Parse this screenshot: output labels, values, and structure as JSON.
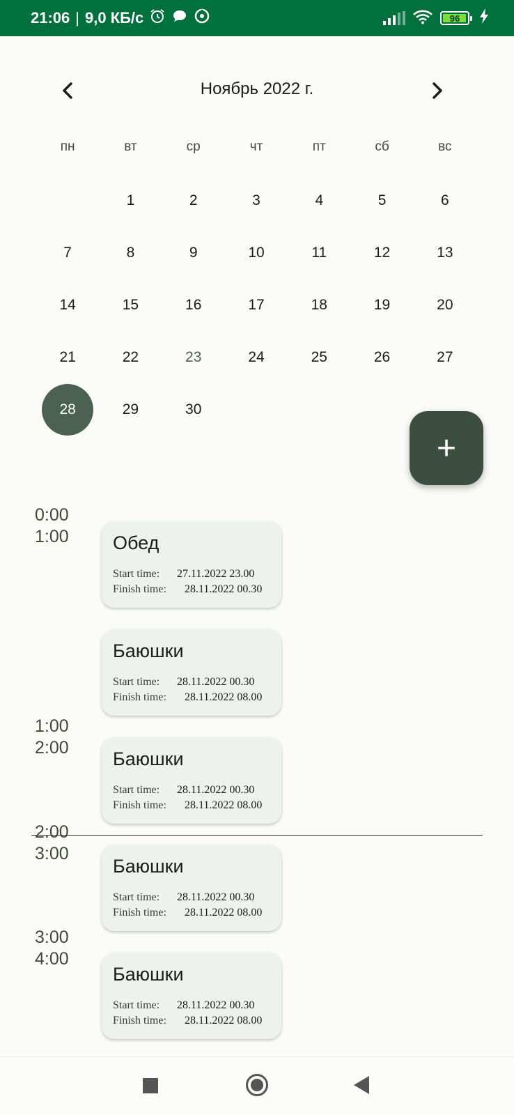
{
  "status_bar": {
    "time": "21:06",
    "separator": "|",
    "speed": "9,0 КБ/с",
    "icons": [
      "alarm-icon",
      "chat-icon",
      "sync-icon"
    ],
    "battery": "96",
    "battery_level": 0.96
  },
  "calendar": {
    "month_title": "Ноябрь 2022 г.",
    "weekdays": [
      "пн",
      "вт",
      "ср",
      "чт",
      "пт",
      "сб",
      "вс"
    ],
    "leading_blank_days": 1,
    "days": [
      "1",
      "2",
      "3",
      "4",
      "5",
      "6",
      "7",
      "8",
      "9",
      "10",
      "11",
      "12",
      "13",
      "14",
      "15",
      "16",
      "17",
      "18",
      "19",
      "20",
      "21",
      "22",
      "23",
      "24",
      "25",
      "26",
      "27",
      "28",
      "29",
      "30"
    ],
    "today": "23",
    "selected": "28"
  },
  "fab": {
    "label": "+"
  },
  "schedule": {
    "slots": [
      {
        "start": "0:00",
        "end": "1:00"
      },
      {
        "start": "1:00",
        "end": "2:00"
      },
      {
        "start": "2:00",
        "end": "3:00"
      },
      {
        "start": "3:00",
        "end": "4:00"
      }
    ],
    "events": [
      {
        "title": "Обед",
        "start_label": "Start time:",
        "start": "27.11.2022 23.00",
        "finish_label": "Finish time:",
        "finish": "28.11.2022 00.30"
      },
      {
        "title": "Баюшки",
        "start_label": "Start time:",
        "start": "28.11.2022 00.30",
        "finish_label": "Finish time:",
        "finish": "28.11.2022 08.00"
      },
      {
        "title": "Баюшки",
        "start_label": "Start time:",
        "start": "28.11.2022 00.30",
        "finish_label": "Finish time:",
        "finish": "28.11.2022 08.00"
      },
      {
        "title": "Баюшки",
        "start_label": "Start time:",
        "start": "28.11.2022 00.30",
        "finish_label": "Finish time:",
        "finish": "28.11.2022 08.00"
      },
      {
        "title": "Баюшки",
        "start_label": "Start time:",
        "start": "28.11.2022 00.30",
        "finish_label": "Finish time:",
        "finish": "28.11.2022 08.00"
      }
    ]
  },
  "nav_bar": {
    "icons": [
      "recents-icon",
      "home-icon",
      "back-icon"
    ]
  }
}
